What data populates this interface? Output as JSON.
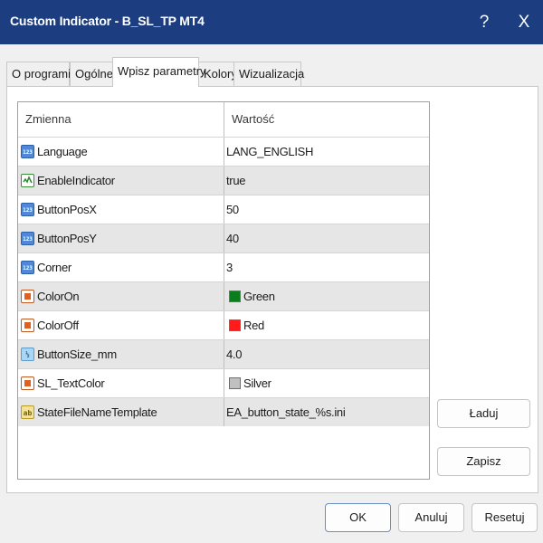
{
  "window": {
    "title": "Custom Indicator - B_SL_TP MT4",
    "help_label": "?",
    "close_label": "X"
  },
  "tabs": [
    {
      "label": "O programie"
    },
    {
      "label": "Ogólne"
    },
    {
      "label": "Wpisz parametry",
      "active": true
    },
    {
      "label": "Kolory"
    },
    {
      "label": "Wizualizacja"
    }
  ],
  "grid": {
    "headers": {
      "name": "Zmienna",
      "value": "Wartość"
    },
    "rows": [
      {
        "name": "Language",
        "value": "LANG_ENGLISH",
        "type": "int",
        "icon_text": "123"
      },
      {
        "name": "EnableIndicator",
        "value": "true",
        "type": "bool",
        "icon_text": ""
      },
      {
        "name": "ButtonPosX",
        "value": "50",
        "type": "int",
        "icon_text": "123"
      },
      {
        "name": "ButtonPosY",
        "value": "40",
        "type": "int",
        "icon_text": "123"
      },
      {
        "name": "Corner",
        "value": "3",
        "type": "int",
        "icon_text": "123"
      },
      {
        "name": "ColorOn",
        "value": "Green",
        "type": "color",
        "swatch": "#0a7d1e",
        "icon_text": ""
      },
      {
        "name": "ColorOff",
        "value": "Red",
        "type": "color",
        "swatch": "#ff1b1b",
        "icon_text": ""
      },
      {
        "name": "ButtonSize_mm",
        "value": "4.0",
        "type": "double",
        "icon_text": "½"
      },
      {
        "name": "SL_TextColor",
        "value": "Silver",
        "type": "color",
        "swatch": "#c0c0c0",
        "icon_text": ""
      },
      {
        "name": "StateFileNameTemplate",
        "value": "EA_button_state_%s.ini",
        "type": "string",
        "icon_text": "ab"
      }
    ]
  },
  "side_buttons": {
    "load": "Ładuj",
    "save": "Zapisz"
  },
  "footer_buttons": {
    "ok": "OK",
    "cancel": "Anuluj",
    "reset": "Resetuj"
  },
  "colors": {
    "titlebar": "#1c3d7f",
    "row_alt": "#e6e6e6"
  }
}
